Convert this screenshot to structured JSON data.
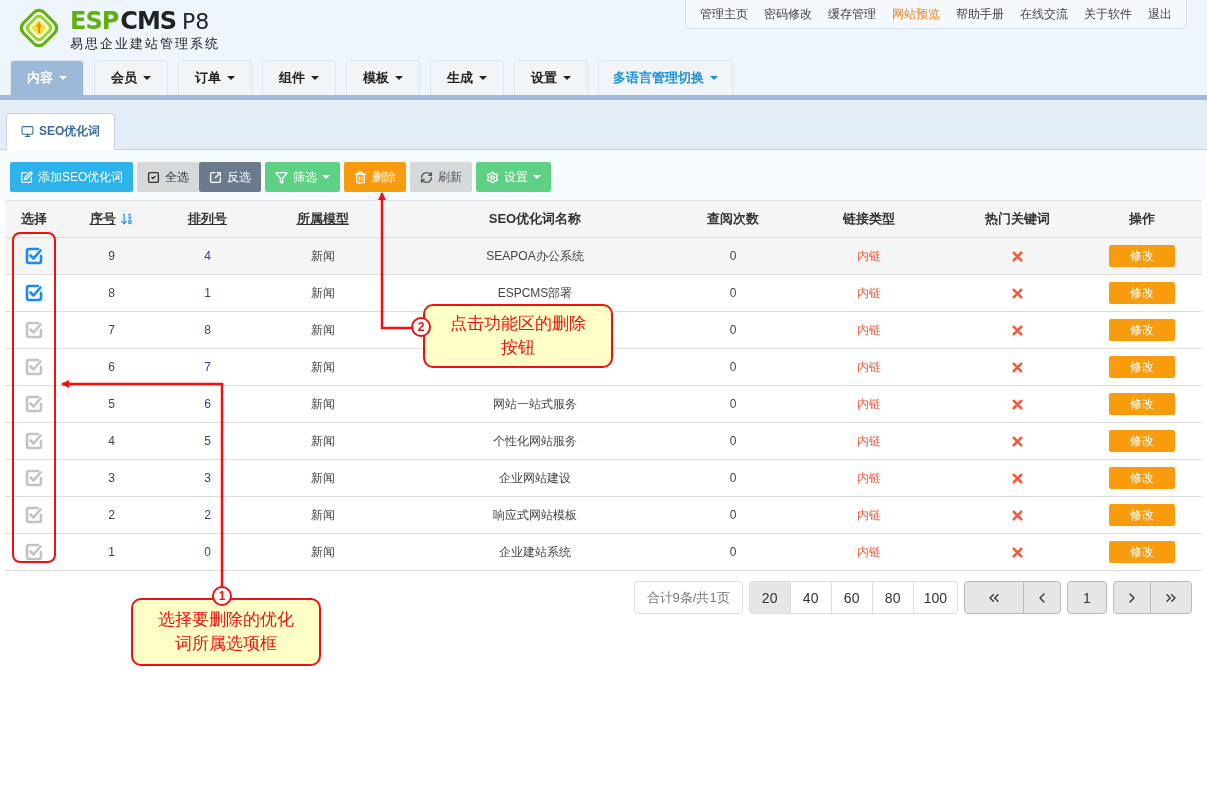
{
  "logo": {
    "brand_accent": "ESP",
    "brand": "CMS",
    "version": "P8",
    "subtitle": "易思企业建站管理系统"
  },
  "top_links": [
    {
      "label": "管理主页",
      "highlighted": false
    },
    {
      "label": "密码修改",
      "highlighted": false
    },
    {
      "label": "缓存管理",
      "highlighted": false
    },
    {
      "label": "网站预览",
      "highlighted": true
    },
    {
      "label": "帮助手册",
      "highlighted": false
    },
    {
      "label": "在线交流",
      "highlighted": false
    },
    {
      "label": "关于软件",
      "highlighted": false
    },
    {
      "label": "退出",
      "highlighted": false
    }
  ],
  "nav_tabs": [
    {
      "label": "内容",
      "selected": true,
      "kind": "menu"
    },
    {
      "label": "会员",
      "selected": false,
      "kind": "menu"
    },
    {
      "label": "订单",
      "selected": false,
      "kind": "menu"
    },
    {
      "label": "组件",
      "selected": false,
      "kind": "menu"
    },
    {
      "label": "模板",
      "selected": false,
      "kind": "menu"
    },
    {
      "label": "生成",
      "selected": false,
      "kind": "menu"
    },
    {
      "label": "设置",
      "selected": false,
      "kind": "menu"
    },
    {
      "label": "多语言管理切换",
      "selected": false,
      "kind": "language"
    }
  ],
  "page_tab": {
    "label": "SEO优化词"
  },
  "toolbar": [
    {
      "label": "添加SEO优化词",
      "kind": "add",
      "dropdown": false
    },
    {
      "label": "全选",
      "kind": "select_all",
      "dropdown": false
    },
    {
      "label": "反选",
      "kind": "invert",
      "dropdown": false
    },
    {
      "label": "筛选",
      "kind": "filter",
      "dropdown": true
    },
    {
      "label": "删除",
      "kind": "delete",
      "dropdown": false
    },
    {
      "label": "刷新",
      "kind": "refresh",
      "dropdown": false
    },
    {
      "label": "设置",
      "kind": "settings",
      "dropdown": true
    }
  ],
  "table": {
    "columns": [
      {
        "label": "选择",
        "sortable": false
      },
      {
        "label": "序号",
        "sortable": true,
        "sorted": true
      },
      {
        "label": "排列号",
        "sortable": true,
        "sorted": false
      },
      {
        "label": "所属模型",
        "sortable": true,
        "sorted": false
      },
      {
        "label": "SEO优化词名称",
        "sortable": false
      },
      {
        "label": "查阅次数",
        "sortable": false
      },
      {
        "label": "链接类型",
        "sortable": false
      },
      {
        "label": "热门关键词",
        "sortable": false
      },
      {
        "label": "操作",
        "sortable": false
      }
    ],
    "rows": [
      {
        "checked": true,
        "id": "9",
        "order": "4",
        "model": "新闻",
        "name": "SEAPOA办公系统",
        "views": "0",
        "link_type": "内链",
        "hot": false,
        "action": "修改"
      },
      {
        "checked": true,
        "id": "8",
        "order": "1",
        "model": "新闻",
        "name": "ESPCMS部署",
        "views": "0",
        "link_type": "内链",
        "hot": false,
        "action": "修改"
      },
      {
        "checked": false,
        "id": "7",
        "order": "8",
        "model": "新闻",
        "views": "0",
        "link_type": "内链",
        "hot": false,
        "action": "修改"
      },
      {
        "checked": false,
        "id": "6",
        "order": "7",
        "model": "新闻",
        "views": "0",
        "link_type": "内链",
        "hot": false,
        "action": "修改"
      },
      {
        "checked": false,
        "id": "5",
        "order": "6",
        "model": "新闻",
        "name": "网站一站式服务",
        "views": "0",
        "link_type": "内链",
        "hot": false,
        "action": "修改"
      },
      {
        "checked": false,
        "id": "4",
        "order": "5",
        "model": "新闻",
        "name": "个性化网站服务",
        "views": "0",
        "link_type": "内链",
        "hot": false,
        "action": "修改"
      },
      {
        "checked": false,
        "id": "3",
        "order": "3",
        "model": "新闻",
        "name": "企业网站建设",
        "views": "0",
        "link_type": "内链",
        "hot": false,
        "action": "修改"
      },
      {
        "checked": false,
        "id": "2",
        "order": "2",
        "model": "新闻",
        "name": "响应式网站模板",
        "views": "0",
        "link_type": "内链",
        "hot": false,
        "action": "修改"
      },
      {
        "checked": false,
        "id": "1",
        "order": "0",
        "model": "新闻",
        "name": "企业建站系统",
        "views": "0",
        "link_type": "内链",
        "hot": false,
        "action": "修改"
      }
    ]
  },
  "pagination": {
    "summary": "合计9条/共1页",
    "page_sizes": [
      {
        "label": "20",
        "selected": true
      },
      {
        "label": "40",
        "selected": false
      },
      {
        "label": "60",
        "selected": false
      },
      {
        "label": "80",
        "selected": false
      },
      {
        "label": "100",
        "selected": false
      }
    ],
    "current_page": "1"
  },
  "annotations": [
    {
      "number": "1",
      "lines": [
        "选择要删除的优化",
        "词所属选项框"
      ]
    },
    {
      "number": "2",
      "lines": [
        "点击功能区的删除",
        "按钮"
      ]
    }
  ]
}
